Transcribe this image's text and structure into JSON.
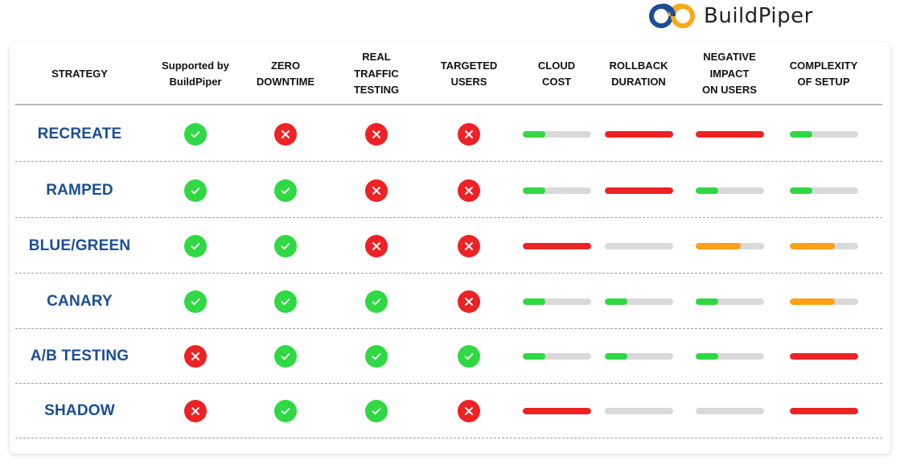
{
  "brand": {
    "name": "BuildPiper",
    "logo_colors": [
      "#1c4d94",
      "#f7a81b"
    ]
  },
  "colors": {
    "strategy_text": "#1c4d94",
    "yes": "#30d843",
    "no": "#ed2224",
    "low": "#30d843",
    "medium": "#fca016",
    "high": "#ed2224",
    "track": "#d9d9d9"
  },
  "columns": [
    {
      "key": "strategy",
      "label": "STRATEGY"
    },
    {
      "key": "supported",
      "label": "Supported by\nBuildPiper"
    },
    {
      "key": "zero_downtime",
      "label": "ZERO\nDOWNTIME"
    },
    {
      "key": "real_traffic",
      "label": "REAL\nTRAFFIC\nTESTING"
    },
    {
      "key": "targeted_users",
      "label": "TARGETED\nUSERS"
    },
    {
      "key": "cloud_cost",
      "label": "CLOUD\nCOST"
    },
    {
      "key": "rollback_duration",
      "label": "ROLLBACK\nDURATION"
    },
    {
      "key": "negative_impact",
      "label": "NEGATIVE\nIMPACT\nON USERS"
    },
    {
      "key": "complexity",
      "label": "COMPLEXITY\nOF SETUP"
    }
  ],
  "rows": [
    {
      "strategy": "RECREATE",
      "supported": true,
      "zero_downtime": false,
      "real_traffic": false,
      "targeted_users": false,
      "cloud_cost": "low",
      "rollback_duration": "high",
      "negative_impact": "high",
      "complexity": "low"
    },
    {
      "strategy": "RAMPED",
      "supported": true,
      "zero_downtime": true,
      "real_traffic": false,
      "targeted_users": false,
      "cloud_cost": "low",
      "rollback_duration": "high",
      "negative_impact": "low",
      "complexity": "low"
    },
    {
      "strategy": "BLUE/GREEN",
      "supported": true,
      "zero_downtime": true,
      "real_traffic": false,
      "targeted_users": false,
      "cloud_cost": "high",
      "rollback_duration": "none",
      "negative_impact": "medium",
      "complexity": "medium"
    },
    {
      "strategy": "CANARY",
      "supported": true,
      "zero_downtime": true,
      "real_traffic": true,
      "targeted_users": false,
      "cloud_cost": "low",
      "rollback_duration": "low",
      "negative_impact": "low",
      "complexity": "medium"
    },
    {
      "strategy": "A/B TESTING",
      "supported": false,
      "zero_downtime": true,
      "real_traffic": true,
      "targeted_users": true,
      "cloud_cost": "low",
      "rollback_duration": "low",
      "negative_impact": "low",
      "complexity": "high"
    },
    {
      "strategy": "SHADOW",
      "supported": false,
      "zero_downtime": true,
      "real_traffic": true,
      "targeted_users": false,
      "cloud_cost": "high",
      "rollback_duration": "none",
      "negative_impact": "none",
      "complexity": "high"
    }
  ],
  "levels": {
    "none": {
      "fill": 0,
      "color": "#d9d9d9"
    },
    "low": {
      "fill": 0.33,
      "color": "#30d843"
    },
    "medium": {
      "fill": 0.66,
      "color": "#fca016"
    },
    "high": {
      "fill": 1.0,
      "color": "#ed2224"
    }
  }
}
